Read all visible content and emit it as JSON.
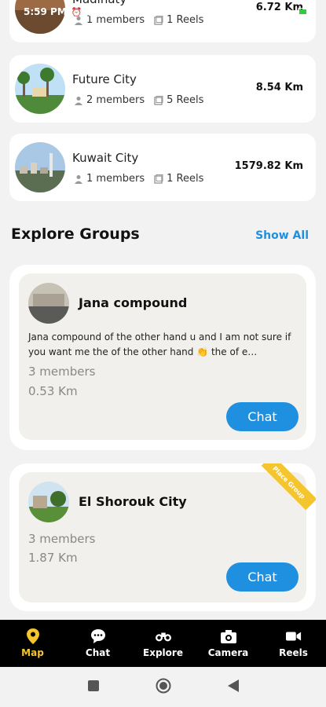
{
  "status_bar": {
    "time": "5:59 PM"
  },
  "cities": [
    {
      "name": "Madinaty",
      "members": "1 members",
      "reels": "1 Reels",
      "distance": "6.72 Km"
    },
    {
      "name": "Future City",
      "members": "2 members",
      "reels": "5 Reels",
      "distance": "8.54 Km"
    },
    {
      "name": "Kuwait City",
      "members": "1 members",
      "reels": "1 Reels",
      "distance": "1579.82 Km"
    }
  ],
  "explore": {
    "title": "Explore Groups",
    "show_all": "Show All"
  },
  "groups": [
    {
      "name": "Jana compound",
      "description": "Jana compound of the other hand u and I am not sure if you want me the of the other hand 👏 the of e…",
      "members": "3 members",
      "distance": "0.53 Km",
      "chat": "Chat"
    },
    {
      "name": "El Shorouk City",
      "members": "3 members",
      "distance": "1.87 Km",
      "chat": "Chat",
      "ribbon": "Place Group"
    }
  ],
  "nav": [
    {
      "label": "Map",
      "icon": "map-pin-icon",
      "active": true
    },
    {
      "label": "Chat",
      "icon": "chat-bubble-icon"
    },
    {
      "label": "Explore",
      "icon": "binoculars-icon"
    },
    {
      "label": "Camera",
      "icon": "camera-icon"
    },
    {
      "label": "Reels",
      "icon": "video-camera-icon"
    }
  ],
  "colors": {
    "accent": "#1f8fe0",
    "active_nav": "#f5c52d",
    "nav_bg": "#000000"
  }
}
